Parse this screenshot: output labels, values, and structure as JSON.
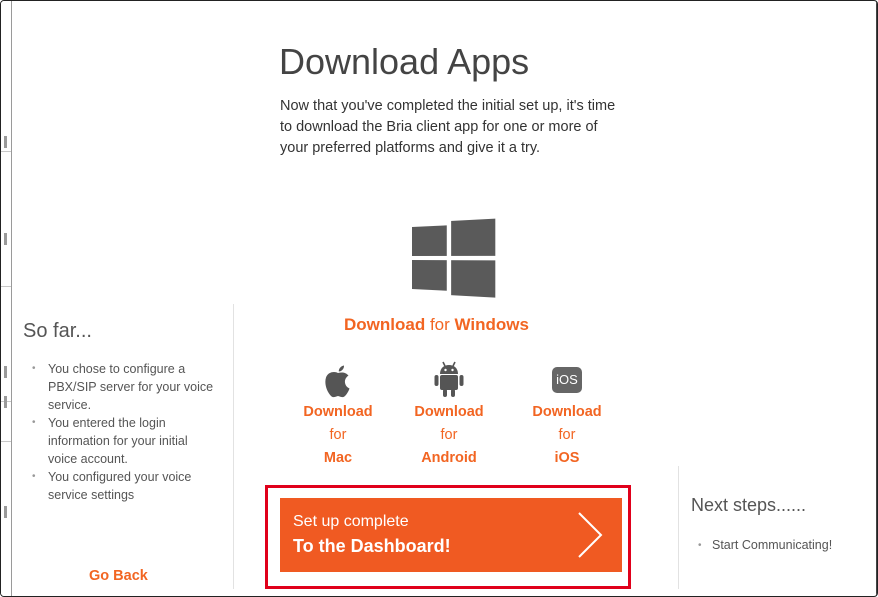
{
  "header": {
    "title": "Download Apps",
    "intro": "Now that you've completed the initial set up, it's time to download the Bria client app for one or more of your preferred platforms and give it a try."
  },
  "windows": {
    "icon": "windows-logo-icon",
    "download": "Download",
    "for": "for",
    "platform": "Windows"
  },
  "platforms": [
    {
      "icon": "apple-icon",
      "line1": "Download",
      "line2": "for",
      "line3": "Mac"
    },
    {
      "icon": "android-icon",
      "line1": "Download",
      "line2": "for",
      "line3": "Android"
    },
    {
      "icon": "ios-icon",
      "icon_text": "iOS",
      "line1": "Download",
      "line2": "for",
      "line3": "iOS"
    }
  ],
  "cta": {
    "small": "Set up complete",
    "big": "To the Dashboard!",
    "icon": "chevron-right-icon"
  },
  "so_far": {
    "title": "So far...",
    "items": [
      "You chose to configure a PBX/SIP server for your voice service.",
      "You entered the login information for your initial voice account.",
      "You configured your voice service settings"
    ],
    "go_back": "Go Back"
  },
  "next_steps": {
    "title": "Next steps......",
    "items": [
      "Start Communicating!"
    ]
  },
  "colors": {
    "accent": "#f26522",
    "cta_bg": "#f05a22",
    "highlight_outline": "#e0001b",
    "icon_gray": "#5a5a5a"
  }
}
